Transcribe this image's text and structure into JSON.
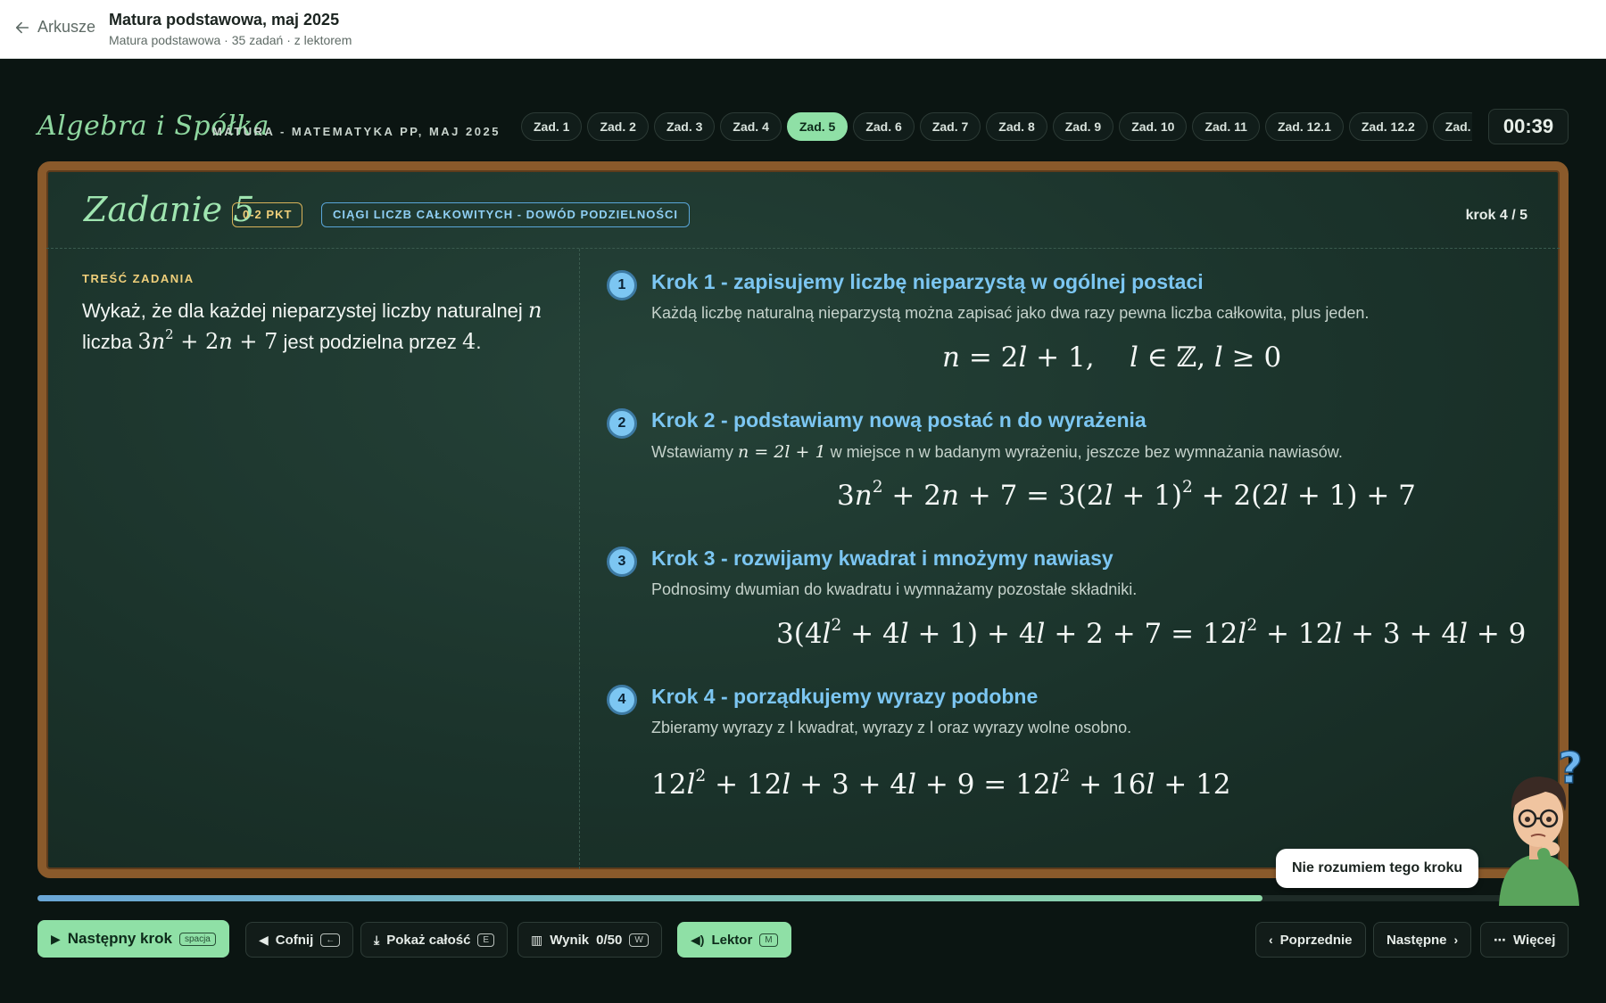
{
  "header": {
    "back_label": "Arkusze",
    "title": "Matura podstawowa, maj 2025",
    "subtitle": "Matura podstawowa · 35 zadań · z lektorem"
  },
  "nav": {
    "brand": "Algebra i Spółka",
    "subbrand": "MATURA - MATEMATYKA PP, MAJ 2025",
    "tabs": [
      "Zad. 1",
      "Zad. 2",
      "Zad. 3",
      "Zad. 4",
      "Zad. 5",
      "Zad. 6",
      "Zad. 7",
      "Zad. 8",
      "Zad. 9",
      "Zad. 10",
      "Zad. 11",
      "Zad. 12.1",
      "Zad. 12.2",
      "Zad."
    ],
    "active_tab": "Zad. 5",
    "timer": "00:39"
  },
  "task": {
    "title": "Zadanie 5",
    "points": "0-2 PKT",
    "topic": "CIĄGI LICZB CAŁKOWITYCH - DOWÓD PODZIELNOŚCI",
    "step_counter": "krok 4 / 5",
    "content_label": "TREŚĆ ZADANIA",
    "content_part1": "Wykaż, że dla każdej nieparzystej liczby naturalnej",
    "content_var": "n",
    "content_part2": "liczba",
    "content_part3": "jest podzielna przez",
    "content_num": "4",
    "content_end": "."
  },
  "steps": [
    {
      "number": "1",
      "title": "Krok 1 - zapisujemy liczbę nieparzystą w ogólnej postaci",
      "description": "Każdą liczbę naturalną nieparzystą można zapisać jako dwa razy pewna liczba całkowita, plus jeden."
    },
    {
      "number": "2",
      "title": "Krok 2 - podstawiamy nową postać n do wyrażenia",
      "description_before": "Wstawiamy",
      "description_after": "w miejsce n w badanym wyrażeniu, jeszcze bez wymnażania nawiasów."
    },
    {
      "number": "3",
      "title": "Krok 3 - rozwijamy kwadrat i mnożymy nawiasy",
      "description": "Podnosimy dwumian do kwadratu i wymnażamy pozostałe składniki."
    },
    {
      "number": "4",
      "title": "Krok 4 - porządkujemy wyrazy podobne",
      "description": "Zbieramy wyrazy z l kwadrat, wyrazy z l oraz wyrazy wolne osobno."
    }
  ],
  "progress": {
    "fraction": 0.8
  },
  "mascot": {
    "speech": "Nie rozumiem tego kroku",
    "icon": "thinking-student-icon"
  },
  "toolbar": {
    "next_step": "Następny krok",
    "next_step_key": "spacja",
    "undo": "Cofnij",
    "undo_key": "←",
    "show_all": "Pokaż całość",
    "show_all_key": "E",
    "score": "Wynik",
    "score_value": "0/50",
    "score_key": "W",
    "lektor": "Lektor",
    "lektor_key": "M",
    "prev": "Poprzednie",
    "next": "Następne",
    "more": "Więcej"
  },
  "colors": {
    "accent_green": "#8fe0a6",
    "step_blue": "#7cc6f2",
    "frame_wood": "#8a5a2b",
    "points_gold": "#f0cf7a"
  }
}
